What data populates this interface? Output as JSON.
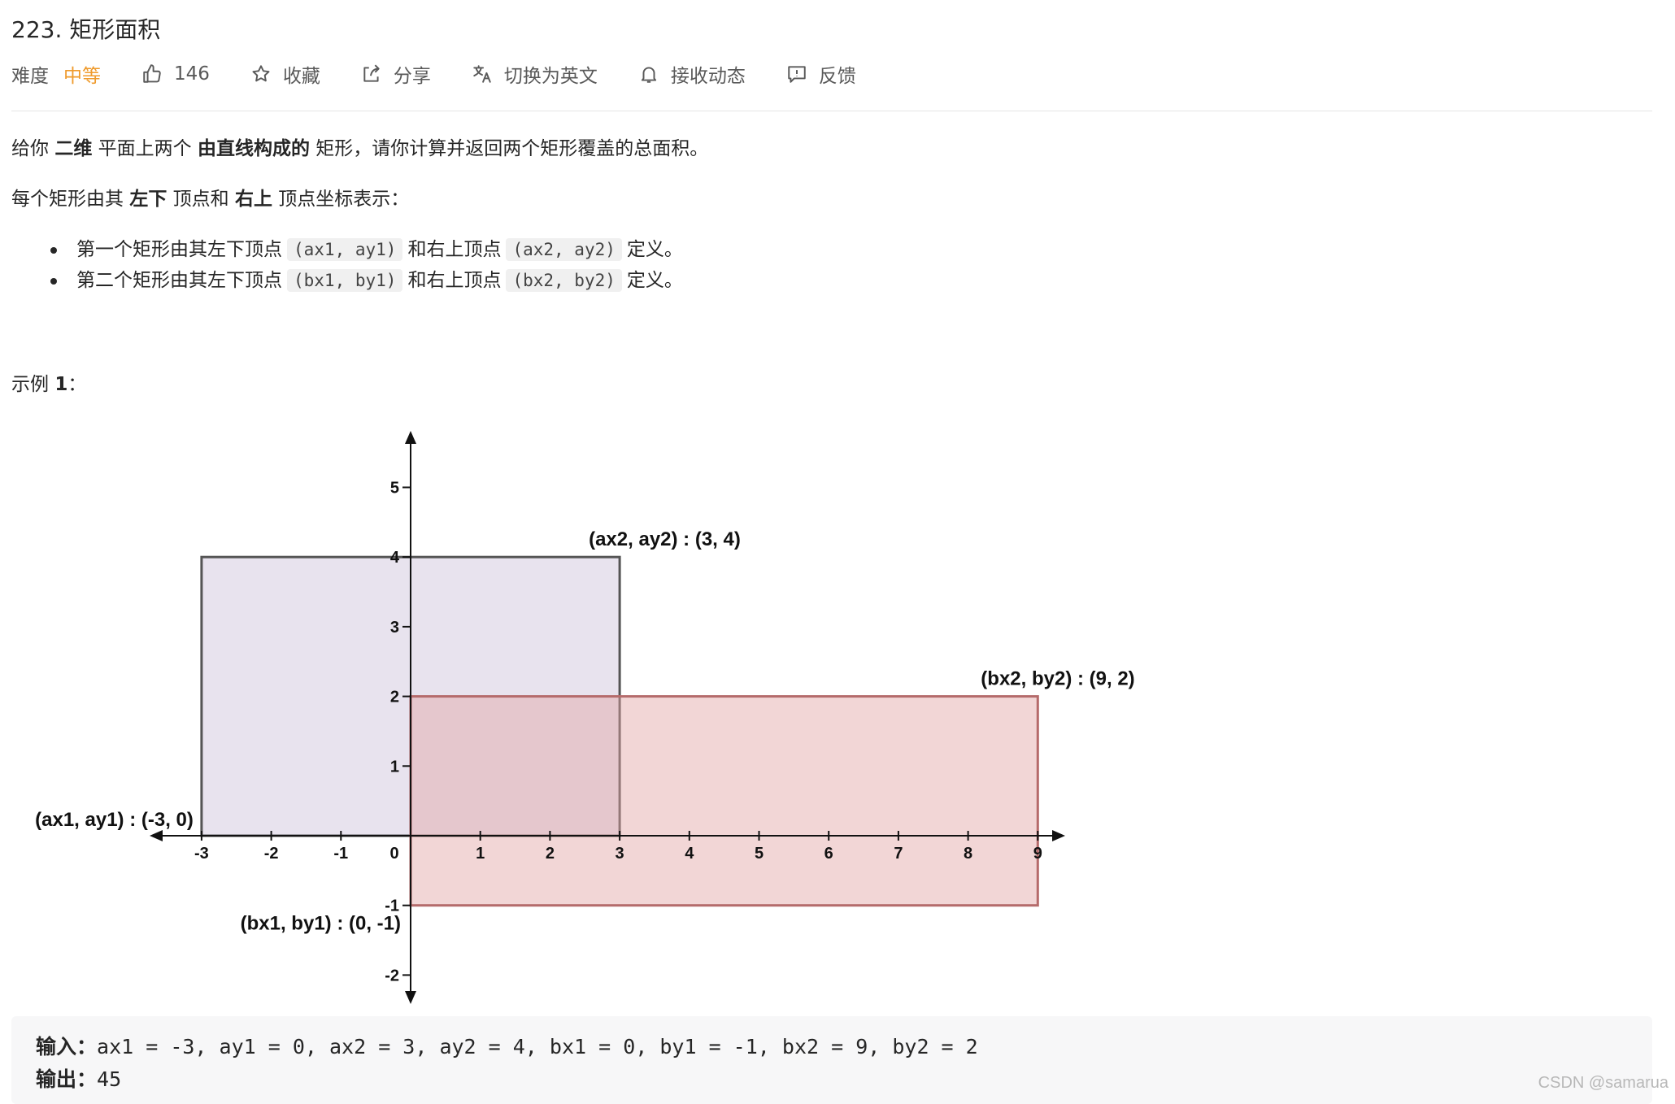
{
  "problem": {
    "title": "223. 矩形面积"
  },
  "toolbar": {
    "difficulty_label": "难度",
    "difficulty_value": "中等",
    "difficulty_color": "#ef9a2b",
    "like_count": "146",
    "collect_label": "收藏",
    "share_label": "分享",
    "switch_lang_label": "切换为英文",
    "subscribe_label": "接收动态",
    "feedback_label": "反馈",
    "icons": [
      "thumbs-up-icon",
      "star-icon",
      "share-icon",
      "translate-icon",
      "bell-icon",
      "feedback-icon"
    ]
  },
  "description": {
    "p1": {
      "t1": "给你 ",
      "b1": "二维",
      "t2": " 平面上两个 ",
      "b2": "由直线构成的",
      "t3": " 矩形，请你计算并返回两个矩形覆盖的总面积。"
    },
    "p2": {
      "t1": "每个矩形由其 ",
      "b1": "左下",
      "t2": " 顶点和 ",
      "b2": "右上",
      "t3": " 顶点坐标表示："
    },
    "bullets": [
      {
        "prefix": "第一个矩形由其左下顶点",
        "code1": "(ax1, ay1)",
        "mid": "和右上顶点",
        "code2": "(ax2, ay2)",
        "suffix": "定义。"
      },
      {
        "prefix": "第二个矩形由其左下顶点",
        "code1": "(bx1, by1)",
        "mid": "和右上顶点",
        "code2": "(bx2, by2)",
        "suffix": "定义。"
      }
    ]
  },
  "example": {
    "title_text": "示例 ",
    "title_num": "1",
    "title_colon": "：",
    "input_label": "输入：",
    "input_value": "ax1 = -3, ay1 = 0, ax2 = 3, ay2 = 4, bx1 = 0, by1 = -1, bx2 = 9, by2 = 2",
    "output_label": "输出：",
    "output_value": "45"
  },
  "diagram": {
    "x_ticks": [
      "-3",
      "-2",
      "-1",
      "0",
      "1",
      "2",
      "3",
      "4",
      "5",
      "6",
      "7",
      "8",
      "9"
    ],
    "y_ticks": [
      "5",
      "4",
      "3",
      "2",
      "1",
      "-1",
      "-2"
    ],
    "rect_a": {
      "x1": -3,
      "y1": 0,
      "x2": 3,
      "y2": 4,
      "fill": "#e6e0ec",
      "stroke": "#555555"
    },
    "rect_b": {
      "x1": 0,
      "y1": -1,
      "x2": 9,
      "y2": 2,
      "fill": "#e3a3a3",
      "stroke": "#b56b6b"
    },
    "labels": {
      "a1": "(ax1, ay1) : (-3, 0)",
      "a2": "(ax2, ay2) : (3, 4)",
      "b1": "(bx1, by1) : (0, -1)",
      "b2": "(bx2, by2) : (9, 2)"
    }
  },
  "watermark": "CSDN @samarua"
}
